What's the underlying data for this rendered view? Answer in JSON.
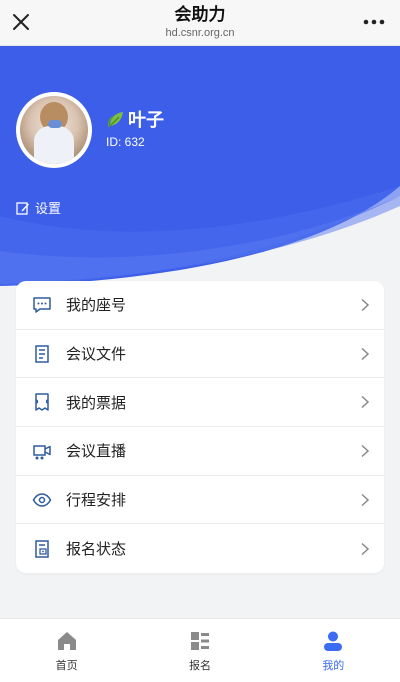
{
  "browser": {
    "title": "会助力",
    "url": "hd.csnr.org.cn"
  },
  "profile": {
    "name": "叶子",
    "id_text": "ID: 632",
    "settings_label": "设置"
  },
  "menu": {
    "items": [
      {
        "label": "我的座号",
        "icon": "chat-seat-icon"
      },
      {
        "label": "会议文件",
        "icon": "document-icon"
      },
      {
        "label": "我的票据",
        "icon": "ticket-icon"
      },
      {
        "label": "会议直播",
        "icon": "live-camera-icon"
      },
      {
        "label": "行程安排",
        "icon": "eye-icon"
      },
      {
        "label": "报名状态",
        "icon": "registration-status-icon"
      }
    ]
  },
  "tabbar": {
    "tabs": [
      {
        "label": "首页",
        "icon": "home-icon",
        "active": false
      },
      {
        "label": "报名",
        "icon": "grid-list-icon",
        "active": false
      },
      {
        "label": "我的",
        "icon": "person-icon",
        "active": true
      }
    ]
  },
  "colors": {
    "brand_blue": "#3c5ee8",
    "active_tab": "#3b6cf2",
    "icon_blue": "#2e5c9e"
  }
}
